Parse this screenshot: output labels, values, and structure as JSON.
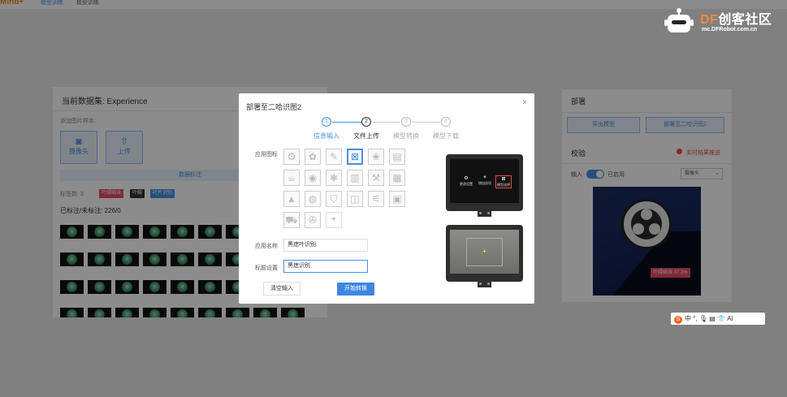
{
  "topbar": {
    "logo": "Mind+",
    "crumb": "模型训练",
    "crumb2": "模型训练"
  },
  "left_panel": {
    "title": "当前数据集: Experience",
    "add_images_label": "添加图片样本:",
    "camera_label": "摄像头",
    "upload_label": "上传",
    "annotate_bar": "数据标注",
    "tag_count": "标签数: 3",
    "tags": [
      {
        "label": "叶绿础当",
        "color": "#e94b6a"
      },
      {
        "label": "叶酸",
        "color": "#333333"
      },
      {
        "label": "叶片识别",
        "color": "#4a90e2"
      }
    ],
    "annotated": "已标注/未标注: 226/0"
  },
  "right_panel": {
    "deploy_title": "部署",
    "export_btn": "导出模型",
    "deploy_btn": "部署至二哈识图2",
    "verify_title": "校验",
    "live_push": "实时结果推送",
    "input_label": "输入",
    "enabled_label": "已启用",
    "camera_select": "摄像头",
    "detection_label": "叶绿础当 37.3%"
  },
  "modal": {
    "title": "部署至二哈识图2",
    "close": "×",
    "steps": [
      {
        "num": "1",
        "label": "信息输入",
        "state": "done"
      },
      {
        "num": "2",
        "label": "文件上传",
        "state": "active"
      },
      {
        "num": "3",
        "label": "模型转换",
        "state": "pending"
      },
      {
        "num": "4",
        "label": "模型下载",
        "state": "pending"
      }
    ],
    "app_icon_label": "应用图标",
    "icons": [
      "gear-icon",
      "gear-outline-icon",
      "tag-icon",
      "leaf-icon",
      "paw-icon",
      "book-icon",
      "cup-icon",
      "apple-icon",
      "cookie-icon",
      "trash-icon",
      "tools-icon",
      "game-icon",
      "stamp-icon",
      "tomato-icon",
      "shirt-icon",
      "camera-icon",
      "network-icon",
      "remote-icon",
      "car-icon",
      "film-icon"
    ],
    "icon_glyphs": [
      "⚙",
      "✿",
      "✎",
      "⊠",
      "❀",
      "▤",
      "☕",
      "◉",
      "❃",
      "▥",
      "⚒",
      "▦",
      "▲",
      "◍",
      "⛉",
      "◫",
      "⚟",
      "▣",
      "⛟",
      "✇"
    ],
    "selected_icon_index": 3,
    "add_icon": "+",
    "app_name_label": "应用名称",
    "app_name_value": "黑痣叶识别",
    "title_label": "标题设置",
    "title_value": "黑痣识别",
    "clear_btn": "清空输入",
    "start_btn": "开始转换"
  },
  "device_preview": {
    "btn_add": "+",
    "btn_settings_label": "更改设置",
    "btn_add_label": "增加选项",
    "btn_model_label": "模型选择"
  },
  "brand": {
    "name_df": "DF",
    "name_rest": "创客社区",
    "url": "mc.DFRobot.com.cn"
  },
  "ime": {
    "logo": "S",
    "items": "中 °, 🎙 ▤ 👕 Aǐ"
  },
  "colors": {
    "accent": "#4a90e2",
    "danger": "#e94b6a",
    "brand_orange": "#f08a3e"
  }
}
